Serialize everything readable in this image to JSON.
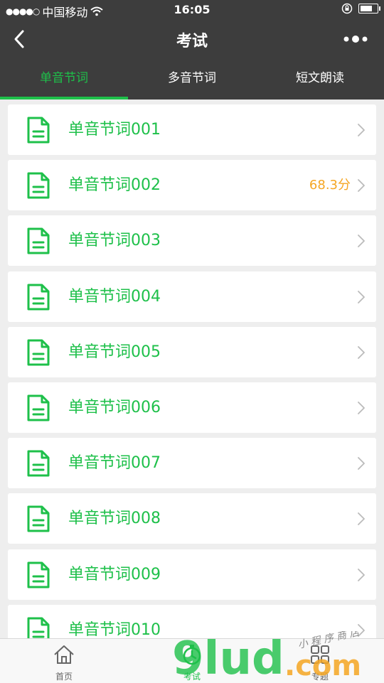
{
  "status_bar": {
    "signal": "●●●●○",
    "carrier": "中国移动",
    "time": "16:05"
  },
  "nav": {
    "title": "考试",
    "back_icon": "chevron-left-icon",
    "more_icon": "more-dots-icon"
  },
  "tabs": [
    {
      "label": "单音节词",
      "active": true
    },
    {
      "label": "多音节词",
      "active": false
    },
    {
      "label": "短文朗读",
      "active": false
    }
  ],
  "items": [
    {
      "label": "单音节词001",
      "score": ""
    },
    {
      "label": "单音节词002",
      "score": "68.3分"
    },
    {
      "label": "单音节词003",
      "score": ""
    },
    {
      "label": "单音节词004",
      "score": ""
    },
    {
      "label": "单音节词005",
      "score": ""
    },
    {
      "label": "单音节词006",
      "score": ""
    },
    {
      "label": "单音节词007",
      "score": ""
    },
    {
      "label": "单音节词008",
      "score": ""
    },
    {
      "label": "单音节词009",
      "score": ""
    },
    {
      "label": "单音节词010",
      "score": ""
    }
  ],
  "tabbar": [
    {
      "label": "首页",
      "icon": "home-icon"
    },
    {
      "label": "考试",
      "icon": "stopwatch-icon"
    },
    {
      "label": "专题",
      "icon": "grid-icon"
    }
  ],
  "watermark": {
    "text": "9lud.com",
    "sub": "小 程 序 商 店"
  },
  "colors": {
    "accent": "#1ec04a",
    "score": "#f5a623",
    "header": "#3d3d3d"
  }
}
